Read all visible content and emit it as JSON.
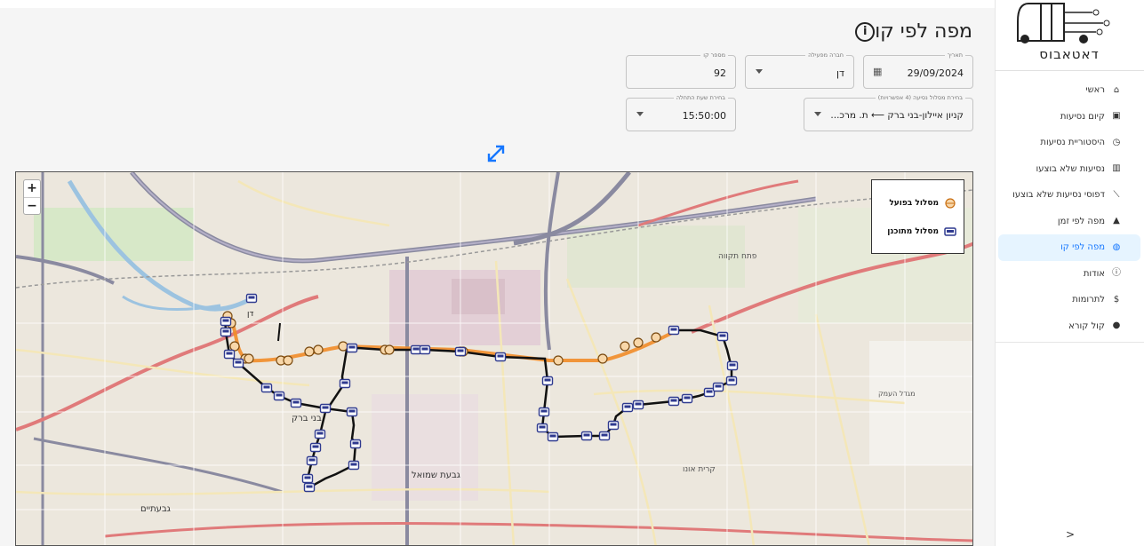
{
  "app": {
    "logo_text": "דאטאבוס"
  },
  "sidebar": {
    "items": [
      {
        "label": "ראשי",
        "icon": "home-icon"
      },
      {
        "label": "קיום נסיעות",
        "icon": "check-box-icon"
      },
      {
        "label": "היסטוריית נסיעות",
        "icon": "clock-icon"
      },
      {
        "label": "נסיעות שלא בוצעו",
        "icon": "bar-chart-icon"
      },
      {
        "label": "דפוסי נסיעות שלא בוצעו",
        "icon": "line-chart-icon"
      },
      {
        "label": "מפה לפי זמן",
        "icon": "radar-icon"
      },
      {
        "label": "מפה לפי קו",
        "icon": "globe-icon",
        "active": true
      },
      {
        "label": "אודות",
        "icon": "info-icon"
      },
      {
        "label": "לתרומות",
        "icon": "dollar-icon"
      },
      {
        "label": "קול קורא",
        "icon": "pin-icon"
      }
    ],
    "collapse_label": "<"
  },
  "page": {
    "title": "מפה לפי קו"
  },
  "filters": {
    "date": {
      "label": "תאריך",
      "value": "29/09/2024"
    },
    "operator": {
      "label": "חברה מפעילה",
      "value": "דן"
    },
    "line_number": {
      "label": "מספר קו",
      "value": "92"
    },
    "route": {
      "label": "בחירת מסלול נסיעה (4 אפשרויות)",
      "value": "קניון איילון-בני ברק ⟵ ת. מרכ..."
    },
    "start_time": {
      "label": "בחירת שעת התחלה",
      "value": "15:50:00"
    }
  },
  "map": {
    "zoom_in": "+",
    "zoom_out": "−",
    "legend": {
      "actual": "מסלול בפועל",
      "planned": "מסלול מתוכנן"
    },
    "operator_tag": "דן",
    "place_labels": [
      "בני ברק",
      "גבעת שמואל",
      "גבעתיים",
      "קרית אונו",
      "מגדל העמק",
      "פתח תקווה"
    ],
    "colors": {
      "actual_route": "#f28c28",
      "planned_route": "#111111",
      "stop_icon": "#2f3a8f"
    }
  }
}
